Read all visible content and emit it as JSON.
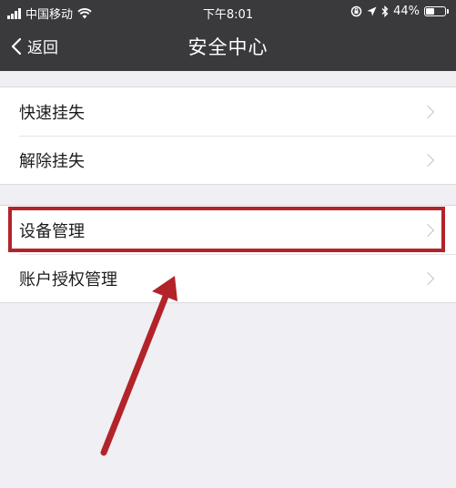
{
  "status_bar": {
    "carrier": "中国移动",
    "time": "下午8:01",
    "battery_percent": "44%",
    "battery_level": 0.44
  },
  "nav": {
    "back_label": "返回",
    "title": "安全中心"
  },
  "groups": [
    {
      "items": [
        {
          "label": "快速挂失"
        },
        {
          "label": "解除挂失"
        }
      ]
    },
    {
      "items": [
        {
          "label": "设备管理"
        },
        {
          "label": "账户授权管理"
        }
      ]
    }
  ],
  "annotation": {
    "highlight_color": "#b3232a",
    "highlighted_item": "设备管理"
  }
}
